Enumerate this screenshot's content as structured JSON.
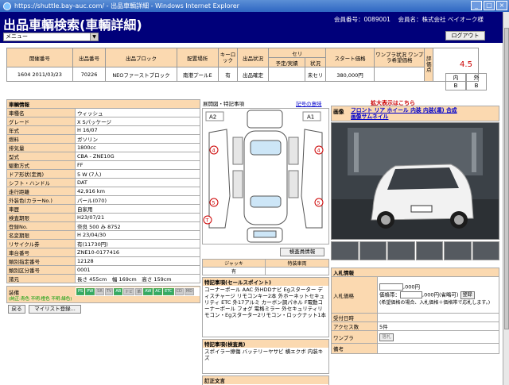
{
  "browser": {
    "title": "https://shuttle.bay-auc.com/ - 出品車輌詳細 - Windows Internet Explorer",
    "controls": [
      "_",
      "□",
      "×"
    ]
  },
  "header": {
    "title": "出品車輌検索(車輌詳細)",
    "member_no_label": "会員番号：0089001",
    "member_name_label": "会員名：株式会社 ベイオーク様",
    "menu_value": "メニュー",
    "logout_label": "ログアウト"
  },
  "lot": {
    "headers": [
      "開催番号",
      "出品番号",
      "出品ブロック",
      "配置場所",
      "キーロック",
      "出品状況",
      "予定/実績",
      "状況",
      "スタート価格",
      "ワンプラ状況 ワンプラ希望価格"
    ],
    "seri_header": "セリ",
    "score_header": "評価点",
    "row": [
      "1604 2011/03/23",
      "70226",
      "NEOファーストブロック",
      "南港プールE",
      "有",
      "出品確定",
      "",
      "未セリ",
      "380,000円",
      ""
    ],
    "score": "4.5",
    "interior_label": "内",
    "interior_grade": "B",
    "exterior_label": "外",
    "exterior_grade": "B"
  },
  "vehicle": {
    "section_title": "車輌情報",
    "rows": [
      {
        "k": "車種名",
        "v": "ウィッシュ"
      },
      {
        "k": "グレード",
        "v": "X Sパッケージ"
      },
      {
        "k": "年式",
        "v": "H 16/07"
      },
      {
        "k": "燃料",
        "v": "ガソリン"
      },
      {
        "k": "排気量",
        "v": "1800cc"
      },
      {
        "k": "型式",
        "v": "CBA - ZNE10G"
      },
      {
        "k": "駆動方式",
        "v": "FF"
      },
      {
        "k": "ドア形状(定員)",
        "v": "5 W (7人)"
      },
      {
        "k": "シフト・ハンドル",
        "v": "DAT"
      },
      {
        "k": "走行距離",
        "v": "42,916 km"
      },
      {
        "k": "外装色(カラーNo.)",
        "v": "パール(070)"
      },
      {
        "k": "車歴",
        "v": "自家用"
      },
      {
        "k": "検査期限",
        "v": "H23/07/21"
      },
      {
        "k": "登録No.",
        "v": "奈良 500 み 8752"
      },
      {
        "k": "名変期限",
        "v": "H 23/04/30"
      },
      {
        "k": "リサイクル券",
        "v": "有(11730円)"
      },
      {
        "k": "車台番号",
        "v": "ZNE10-0177416"
      },
      {
        "k": "類別指定番号",
        "v": "12128"
      },
      {
        "k": "類別区分番号",
        "v": "0001"
      },
      {
        "k": "諸元",
        "v": "長さ 455cm　幅 169cm　高さ 159cm"
      }
    ],
    "equip_label": "装備",
    "equip_sub": "(純正:青色 不明:橙色 不明:緑色)",
    "equip_badges": [
      {
        "t": "PS",
        "on": true
      },
      {
        "t": "PW",
        "on": true
      },
      {
        "t": "SR",
        "on": false
      },
      {
        "t": "TV",
        "on": false
      },
      {
        "t": "AB",
        "on": true
      },
      {
        "t": "ナビ",
        "on": false
      },
      {
        "t": "革",
        "on": false
      },
      {
        "t": "AW",
        "on": true
      },
      {
        "t": "AC",
        "on": true
      },
      {
        "t": "ETC",
        "on": true
      },
      {
        "t": "CD",
        "on": false
      },
      {
        "t": "MD",
        "on": false
      }
    ],
    "back_label": "戻る",
    "mylist_label": "マイリスト登録..."
  },
  "diagram": {
    "title": "展開図・特記事項",
    "symbols_link": "記号の意味",
    "marks": [
      "A2",
      "A1",
      "4",
      "4",
      "5",
      "5",
      "T"
    ],
    "inspect_button": "検査員情報",
    "jack_headers": [
      "ジャッキ",
      "特装車両"
    ],
    "jack_values": [
      "有",
      ""
    ]
  },
  "sales_points": {
    "title": "特記事項(セールスポイント)",
    "body": "コーナーポール AAC 外HDDナビ Egスターター ディスチャージ リモコンキー2本 外ホーネットセキュリティ ETC 外17アルミ カーボン調パネル F電動コーナーポール フォグ 電格ミラー 外セキュリティリモコン・Egスターター2リモコン・ロックナット1本"
  },
  "inspector": {
    "title": "特記事項(検査員)",
    "body": "スポイラー擦傷 バッテリーヤサビ 横エクボ 内装キズ"
  },
  "correction": {
    "title": "訂正文言",
    "body": ""
  },
  "images": {
    "enlarge_note": "拡大表示はこちら",
    "label": "画像",
    "links_line1": "フロント リア ホイール 内装 内装(運) 合成",
    "links_line2": "画像サムネイル",
    "thumb_count": 6
  },
  "bid": {
    "section_title": "入札情報",
    "price_label": "入札価格",
    "price_unit": ",000円",
    "price_hint_label": "価格帯：",
    "price_hint_unit": ",000円(省略可)",
    "register_label": "登録",
    "note": "(希望価格の場合、入札価格＋価格帯で応札します。)",
    "period_label": "受付日時",
    "access_label": "アクセス数",
    "access_value": "5件",
    "onepla_label": "ワンプラ",
    "onepla_button": "落札",
    "remarks_label": "備考"
  }
}
